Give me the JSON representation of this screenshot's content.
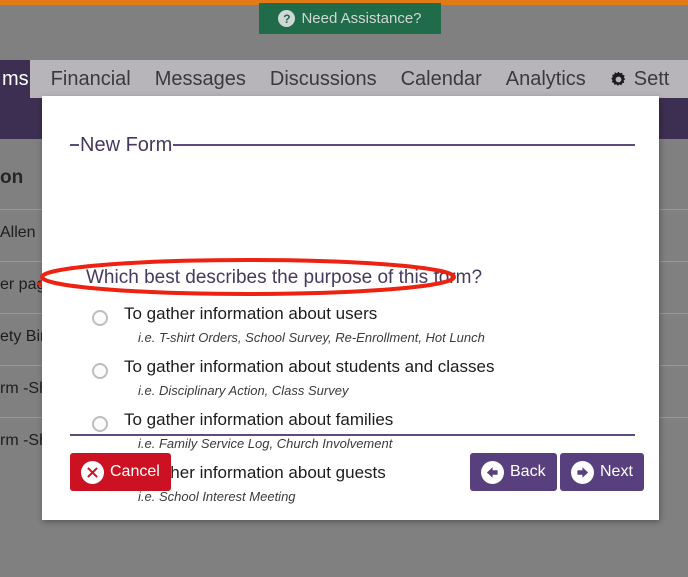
{
  "colors": {
    "accent_purple": "#583f7d",
    "dark_purple": "#3d2f51",
    "legend_purple": "#5b4b7f",
    "cancel_red": "#cc1122",
    "assist_green": "#1f6b4a",
    "top_strip_orange": "#e07b18",
    "page_gray": "#808080",
    "annotation_red": "#ee2211"
  },
  "topbar": {
    "assistance_label": "Need Assistance?",
    "assistance_icon": "question-mark-circle-icon"
  },
  "nav": {
    "items": [
      {
        "label": "ms",
        "active": true,
        "icon": null
      },
      {
        "label": "Financial",
        "active": false,
        "icon": null
      },
      {
        "label": "Messages",
        "active": false,
        "icon": null
      },
      {
        "label": "Discussions",
        "active": false,
        "icon": null
      },
      {
        "label": "Calendar",
        "active": false,
        "icon": null
      },
      {
        "label": "Analytics",
        "active": false,
        "icon": null
      },
      {
        "label": "Sett",
        "active": false,
        "icon": "gear-icon"
      }
    ]
  },
  "background": {
    "heading": "on",
    "rows": [
      {
        "text": "Allen"
      },
      {
        "text": "er page"
      },
      {
        "text": "ety Bird"
      },
      {
        "text": "rm -Sha"
      },
      {
        "text": "rm -Sha"
      }
    ]
  },
  "modal": {
    "legend": "New Form",
    "question": "Which best describes the purpose of this form?",
    "options": [
      {
        "label": "To gather information about users",
        "hint": "i.e. T-shirt Orders, School Survey, Re-Enrollment, Hot Lunch",
        "selected": false
      },
      {
        "label": "To gather information about students and classes",
        "hint": "i.e. Disciplinary Action, Class Survey",
        "selected": false,
        "annotated": true
      },
      {
        "label": "To gather information about families",
        "hint": "i.e. Family Service Log, Church Involvement",
        "selected": false
      },
      {
        "label": "To gather information about guests",
        "hint": "i.e. School Interest Meeting",
        "selected": false
      }
    ],
    "buttons": {
      "cancel": {
        "label": "Cancel",
        "icon": "x-circle-icon"
      },
      "back": {
        "label": "Back",
        "icon": "arrow-left-circle-icon"
      },
      "next": {
        "label": "Next",
        "icon": "arrow-right-circle-icon"
      }
    }
  }
}
